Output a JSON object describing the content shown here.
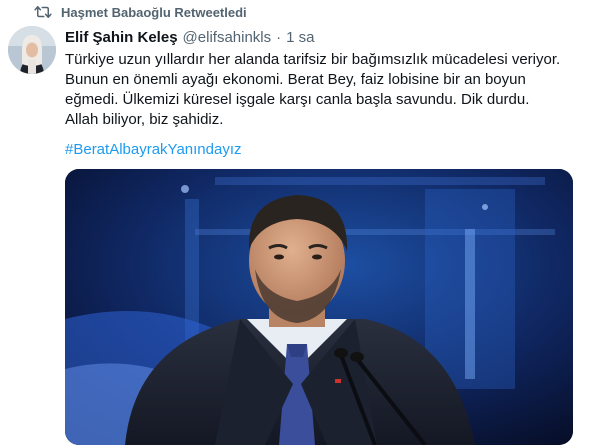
{
  "retweet": {
    "label": "Haşmet Babaoğlu Retweetledi",
    "icon": "retweet-icon"
  },
  "tweet": {
    "author_name": "Elif Şahin Keleş",
    "author_handle": "@elifsahinkls",
    "separator": "·",
    "time": "1 sa",
    "text": "Türkiye uzun yıllardır her alanda tarifsiz bir bağımsızlık mücadelesi veriyor.\nBunun en önemli ayağı ekonomi. Berat Bey, faiz lobisine bir an boyun\neğmedi. Ülkemizi küresel işgale karşı canla başla savundu. Dik durdu.\nAllah biliyor, biz şahidiz.",
    "hashtag": "#BeratAlbayrakYanındayız"
  },
  "colors": {
    "accent": "#1d9bf0",
    "muted": "#536471",
    "text": "#0f1419"
  }
}
